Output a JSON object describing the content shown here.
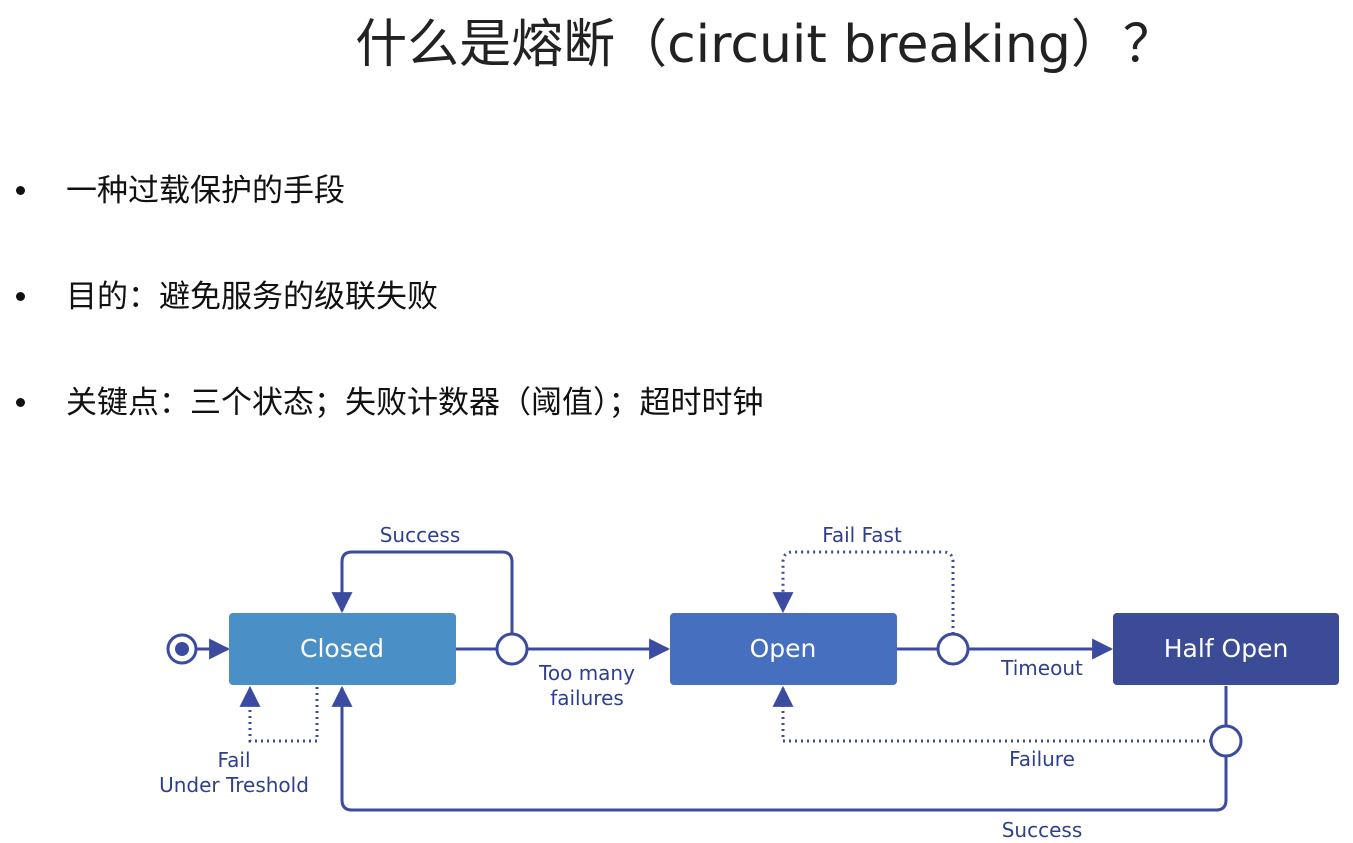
{
  "title": "什么是熔断（circuit breaking）？",
  "bullets": [
    "一种过载保护的手段",
    "目的：避免服务的级联失败",
    "关键点：三个状态；失败计数器（阈值）；超时时钟"
  ],
  "diagram": {
    "states": {
      "closed": "Closed",
      "open": "Open",
      "half_open": "Half Open"
    },
    "transitions": {
      "closed_success": "Success",
      "fail_under_threshold_1": "Fail",
      "fail_under_threshold_2": "Under Treshold",
      "too_many_failures_1": "Too many",
      "too_many_failures_2": "failures",
      "fail_fast": "Fail Fast",
      "timeout": "Timeout",
      "failure": "Failure",
      "half_open_success": "Success"
    },
    "colors": {
      "closed": "#4a90c6",
      "open": "#4670bf",
      "half_open": "#3b4b96",
      "line": "#3b4ba0"
    }
  }
}
